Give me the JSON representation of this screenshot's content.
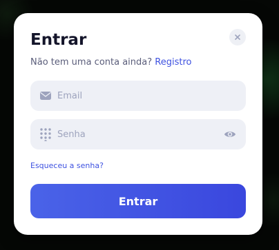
{
  "modal": {
    "title": "Entrar",
    "close_icon": "close-icon",
    "subtitle": {
      "text": "Não tem uma conta ainda?",
      "link_label": "Registro"
    },
    "email": {
      "icon": "envelope-icon",
      "placeholder": "Email",
      "value": ""
    },
    "password": {
      "icon": "dial-pad-icon",
      "placeholder": "Senha",
      "value": "",
      "toggle_icon": "eye-icon"
    },
    "forgot_label": "Esqueceu a senha?",
    "submit_label": "Entrar"
  },
  "colors": {
    "accent": "#3d51e0",
    "button_gradient_start": "#4a63e8",
    "button_gradient_end": "#3a47de",
    "field_background": "#eef0f6",
    "title": "#14152a",
    "icon": "#9da3bd"
  }
}
